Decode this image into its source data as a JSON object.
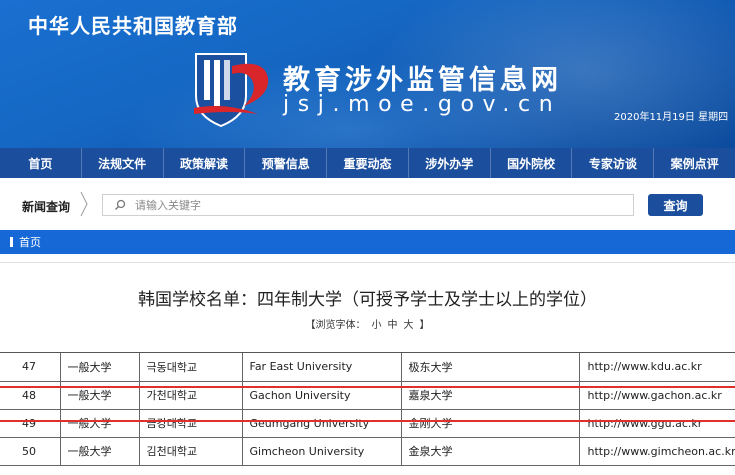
{
  "header": {
    "ministry": "中华人民共和国教育部",
    "site_title": "教育涉外监管信息网",
    "site_url": "jsj.moe.gov.cn",
    "date": "2020年11月19日 星期四",
    "logo_icon": "jsj-logo-icon"
  },
  "nav": {
    "items": [
      "首页",
      "法规文件",
      "政策解读",
      "预警信息",
      "重要动态",
      "涉外办学",
      "国外院校",
      "专家访谈",
      "案例点评"
    ]
  },
  "search": {
    "label": "新闻查询",
    "placeholder": "请输入关键字",
    "button": "查询",
    "icon": "search-icon"
  },
  "breadcrumb": {
    "home": "首页"
  },
  "article": {
    "title": "韩国学校名单：四年制大学（可授予学士及学士以上的学位）",
    "font_size_label": "【浏览字体：",
    "font_small": "小",
    "font_medium": "中",
    "font_large": "大",
    "font_size_end": "】"
  },
  "table": {
    "rows": [
      {
        "num": "47",
        "type": "一般大学",
        "korean": "극동대학교",
        "english": "Far East  University",
        "chinese": "极东大学",
        "url": "http://www.kdu.ac.kr"
      },
      {
        "num": "48",
        "type": "一般大学",
        "korean": "가천대학교",
        "english": "Gachon  University",
        "chinese": "嘉泉大学",
        "url": "http://www.gachon.ac.kr"
      },
      {
        "num": "49",
        "type": "一般大学",
        "korean": "금강대학교",
        "english": "Geumgang  University",
        "chinese": "金刚大学",
        "url": "http://www.ggu.ac.kr"
      },
      {
        "num": "50",
        "type": "一般大学",
        "korean": "김천대학교",
        "english": "Gimcheon  University",
        "chinese": "金泉大学",
        "url": "http://www.gimcheon.ac.kr"
      }
    ]
  },
  "colors": {
    "nav_bg": "#1b4e9c",
    "breadcrumb_bg": "#1668d6",
    "highlight": "#e0302a",
    "logo_red": "#d8262a"
  }
}
